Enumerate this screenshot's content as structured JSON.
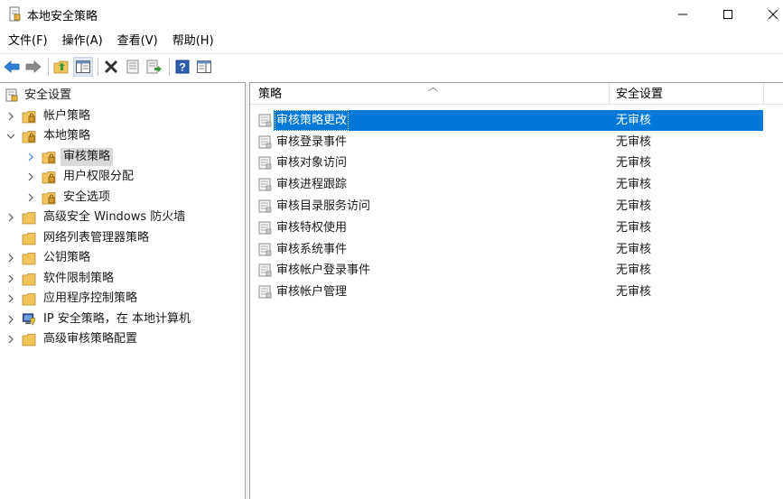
{
  "window": {
    "title": "本地安全策略",
    "icon": "local-security-policy-icon",
    "controls": [
      "minimize-icon",
      "maximize-icon",
      "close-icon"
    ]
  },
  "menu": {
    "items": [
      "文件(F)",
      "操作(A)",
      "查看(V)",
      "帮助(H)"
    ]
  },
  "toolbar": {
    "buttons": [
      "back-arrow-icon",
      "forward-arrow-icon",
      "up-folder-icon",
      "show-hide-tree-icon",
      "delete-icon",
      "properties-icon",
      "export-list-icon",
      "help-icon",
      "show-action-pane-icon"
    ]
  },
  "tree": {
    "root": "安全设置",
    "items": [
      {
        "label": "帐户策略",
        "expanded": false
      },
      {
        "label": "本地策略",
        "expanded": true
      },
      {
        "label": "审核策略",
        "selected": true
      },
      {
        "label": "用户权限分配"
      },
      {
        "label": "安全选项"
      },
      {
        "label": "高级安全 Windows 防火墙"
      },
      {
        "label": "网络列表管理器策略"
      },
      {
        "label": "公钥策略"
      },
      {
        "label": "软件限制策略"
      },
      {
        "label": "应用程序控制策略"
      },
      {
        "label": "IP 安全策略，在 本地计算机"
      },
      {
        "label": "高级审核策略配置"
      }
    ]
  },
  "list": {
    "columns": [
      "策略",
      "安全设置"
    ],
    "rows": [
      {
        "policy": "审核策略更改",
        "setting": "无审核",
        "selected": true
      },
      {
        "policy": "审核登录事件",
        "setting": "无审核"
      },
      {
        "policy": "审核对象访问",
        "setting": "无审核"
      },
      {
        "policy": "审核进程跟踪",
        "setting": "无审核"
      },
      {
        "policy": "审核目录服务访问",
        "setting": "无审核"
      },
      {
        "policy": "审核特权使用",
        "setting": "无审核"
      },
      {
        "policy": "审核系统事件",
        "setting": "无审核"
      },
      {
        "policy": "审核帐户登录事件",
        "setting": "无审核"
      },
      {
        "policy": "审核帐户管理",
        "setting": "无审核"
      }
    ]
  },
  "colors": {
    "selection": "#0078d7",
    "tree_selection": "#d9d9d9",
    "folder": "#f2c55c"
  }
}
